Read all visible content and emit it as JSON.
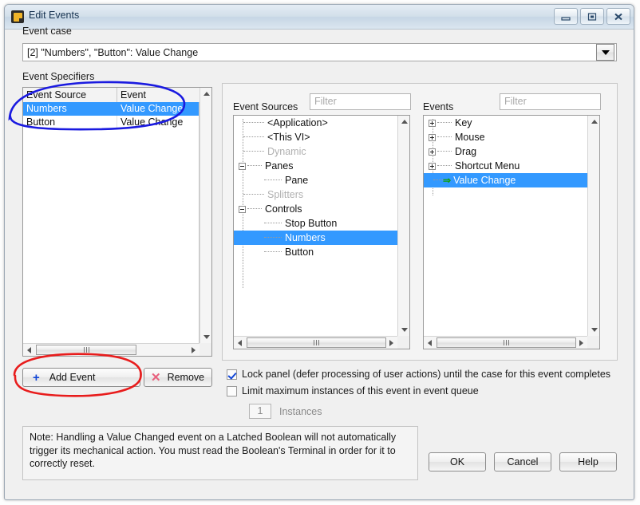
{
  "window": {
    "title": "Edit Events",
    "icon": "labview-vi-icon",
    "controls": {
      "minimize": "minimize",
      "maximize": "maximize",
      "close": "close"
    }
  },
  "event_case": {
    "label": "Event case",
    "value": "[2] \"Numbers\", \"Button\": Value Change",
    "dropdown_icon": "chevron-down-icon"
  },
  "specifiers": {
    "label": "Event Specifiers",
    "columns": [
      "Event Source",
      "Event"
    ],
    "rows": [
      {
        "source": "Numbers",
        "event": "Value Change",
        "selected": true
      },
      {
        "source": "Button",
        "event": "Value Change",
        "selected": false
      }
    ]
  },
  "sources": {
    "label": "Event Sources",
    "filter_placeholder": "Filter",
    "filter_value": "",
    "tree": [
      {
        "label": "<Application>",
        "depth": 1,
        "expander": "none",
        "state": "normal"
      },
      {
        "label": "<This VI>",
        "depth": 1,
        "expander": "none",
        "state": "normal"
      },
      {
        "label": "Dynamic",
        "depth": 1,
        "expander": "none",
        "state": "disabled"
      },
      {
        "label": "Panes",
        "depth": 0,
        "expander": "minus",
        "state": "normal"
      },
      {
        "label": "Pane",
        "depth": 2,
        "expander": "none",
        "state": "normal"
      },
      {
        "label": "Splitters",
        "depth": 1,
        "expander": "none",
        "state": "disabled"
      },
      {
        "label": "Controls",
        "depth": 0,
        "expander": "minus",
        "state": "normal"
      },
      {
        "label": "Stop Button",
        "depth": 2,
        "expander": "none",
        "state": "normal"
      },
      {
        "label": "Numbers",
        "depth": 2,
        "expander": "none",
        "state": "selected"
      },
      {
        "label": "Button",
        "depth": 2,
        "expander": "none",
        "state": "normal"
      }
    ]
  },
  "events": {
    "label": "Events",
    "filter_placeholder": "Filter",
    "filter_value": "",
    "tree": [
      {
        "label": "Key",
        "depth": 0,
        "expander": "plus",
        "state": "normal"
      },
      {
        "label": "Mouse",
        "depth": 0,
        "expander": "plus",
        "state": "normal"
      },
      {
        "label": "Drag",
        "depth": 0,
        "expander": "plus",
        "state": "normal"
      },
      {
        "label": "Shortcut Menu",
        "depth": 0,
        "expander": "plus",
        "state": "normal"
      },
      {
        "label": "Value Change",
        "depth": 0,
        "expander": "arrow",
        "state": "selected"
      }
    ]
  },
  "actions": {
    "add_event": "Add Event",
    "add_event_icon": "plus-icon",
    "remove": "Remove",
    "remove_icon": "x-icon"
  },
  "options": {
    "lock_panel": {
      "label": "Lock panel (defer processing of user actions) until the case for this event completes",
      "checked": true
    },
    "limit_instances": {
      "label": "Limit maximum instances of this event in event queue",
      "checked": false
    },
    "instances": {
      "value": "1",
      "label": "Instances"
    }
  },
  "note": "Note:  Handling a Value Changed event on a Latched Boolean will not automatically trigger its mechanical action. You must read the Boolean's Terminal in order for it to correctly reset.",
  "dialog_buttons": {
    "ok": "OK",
    "cancel": "Cancel",
    "help": "Help"
  },
  "colors": {
    "selection": "#3399ff",
    "annotation_blue": "#1a1ae0",
    "annotation_red": "#e81c1c",
    "plus_icon": "#1145d6",
    "x_icon": "#e8607d",
    "arrow_icon": "#10a010"
  },
  "annotations": [
    {
      "shape": "ellipse",
      "color": "#1a1ae0",
      "target": "specifiers-selected-rows"
    },
    {
      "shape": "ellipse",
      "color": "#e81c1c",
      "target": "add-event-button"
    }
  ]
}
